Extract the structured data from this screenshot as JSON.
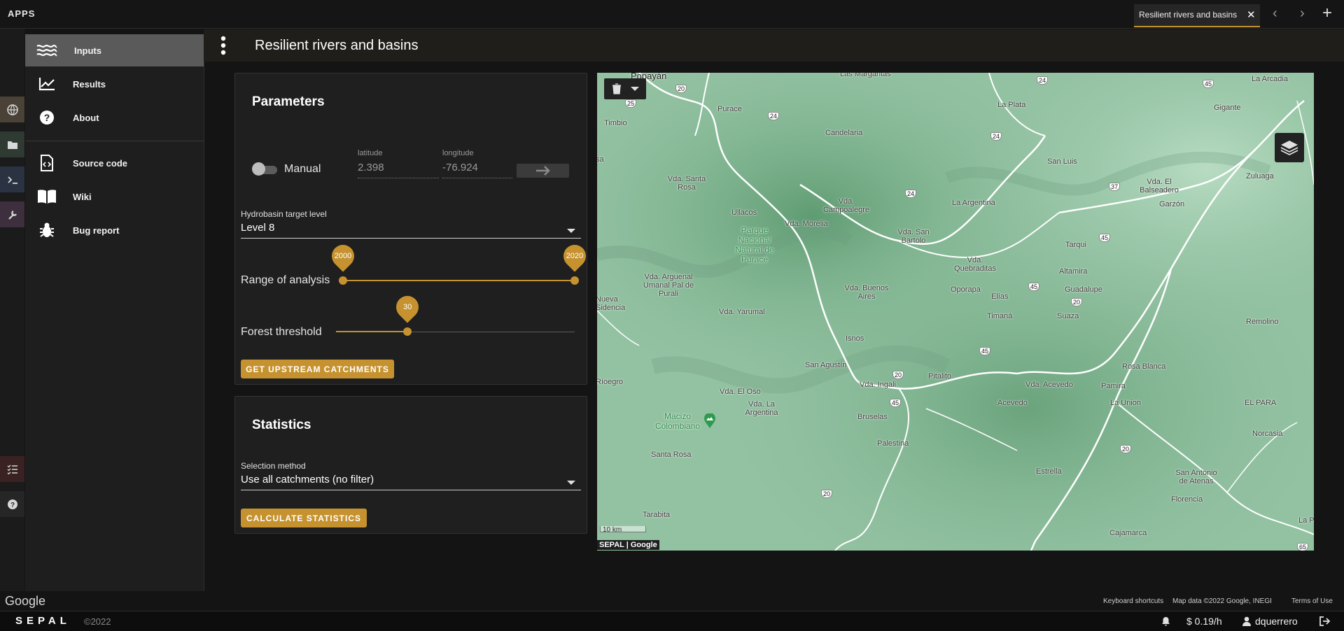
{
  "topbar": {
    "apps_label": "APPS",
    "tab_title": "Resilient rivers and basins",
    "close_glyph": "✕",
    "back_glyph": "‹",
    "forward_glyph": "›",
    "add_glyph": "+"
  },
  "rail": {
    "items": [
      "globe-icon",
      "folder-icon",
      "terminal-icon",
      "wrench-icon",
      "tasks-icon",
      "help-icon"
    ]
  },
  "drawer": {
    "items": [
      {
        "label": "Inputs",
        "icon": "waves-icon"
      },
      {
        "label": "Results",
        "icon": "chart-line-icon"
      },
      {
        "label": "About",
        "icon": "help-circle-icon"
      },
      {
        "label": "Source code",
        "icon": "file-code-icon"
      },
      {
        "label": "Wiki",
        "icon": "book-icon"
      },
      {
        "label": "Bug report",
        "icon": "bug-icon"
      }
    ],
    "active": "Inputs"
  },
  "appbar": {
    "title": "Resilient rivers and basins"
  },
  "parameters": {
    "title": "Parameters",
    "manual_label": "Manual",
    "manual_on": false,
    "latitude_label": "latitude",
    "latitude_value": "2.398",
    "longitude_label": "longitude",
    "longitude_value": "-76.924",
    "hydrobasin_label": "Hydrobasin target level",
    "hydrobasin_value": "Level 8",
    "range_label": "Range of analysis",
    "range_start": "2000",
    "range_end": "2020",
    "forest_label": "Forest threshold",
    "forest_value": "30",
    "forest_fraction": 0.3,
    "get_button": "GET UPSTREAM CATCHMENTS"
  },
  "statistics": {
    "title": "Statistics",
    "selection_label": "Selection method",
    "selection_value": "Use all catchments (no filter)",
    "calc_button": "CALCULATE STATISTICS"
  },
  "map": {
    "labels": [
      "Popayán",
      "Purace",
      "Timbio",
      "La Plata",
      "Candelaria",
      "Gigante",
      "La Arcadia",
      "San Luis",
      "Zuluaga",
      "Vda. El Balseadero",
      "Garzón",
      "Vda. Santa Rosa",
      "Ullacos",
      "Vda. Campoalegre",
      "La Argentina",
      "Vda. Morelia",
      "Vda. San Bartolo",
      "Tarqui",
      "Vda. Quebraditas",
      "Altamira",
      "Vda. Arguenal Umanal Pal de Purali",
      "Vda. Buenos Aires",
      "Oporapa",
      "Elías",
      "Guadalupe",
      "Nueva Sidencia",
      "Vda. Yarumal",
      "Timaná",
      "Suaza",
      "Remolino",
      "Isnos",
      "San Agustín",
      "Pitalito",
      "Vda. Ingali",
      "Vda. Acevedo",
      "Pamira",
      "Rosa Blanca",
      "La Union",
      "EL PARA",
      "Vda. El Oso",
      "Vda. La Argentina",
      "Bruselas",
      "Acevedo",
      "Norcasia",
      "Santa Rosa",
      "Palestina",
      "Estrella",
      "San Antonio de Atenas",
      "Florencia",
      "Tarabita",
      "Cajamarca",
      "Las Margaritas",
      "La Pa",
      "Ríoegro",
      "sa"
    ],
    "green_labels": [
      "Parque Nacional Natural de Puracé",
      "Macizo Colombiano"
    ],
    "route_shields": [
      "20",
      "25",
      "24",
      "24",
      "45",
      "24",
      "37",
      "45",
      "45",
      "20",
      "20",
      "45",
      "45",
      "20",
      "65",
      "24"
    ],
    "scale": "10 km",
    "attribution": "SEPAL | Google",
    "delete_icon": "trash-icon",
    "layers_icon": "layers-icon"
  },
  "google_strip": {
    "logo": "Google",
    "shortcuts": "Keyboard shortcuts",
    "map_data": "Map data ©2022 Google, INEGI",
    "terms": "Terms of Use"
  },
  "footer": {
    "brand": "SEPAL",
    "copyright": "©2022",
    "cost": "$ 0.19/h",
    "user": "dquerrero"
  },
  "colors": {
    "accent": "#c6922f",
    "background": "#141414",
    "card": "#1f1f1f"
  }
}
